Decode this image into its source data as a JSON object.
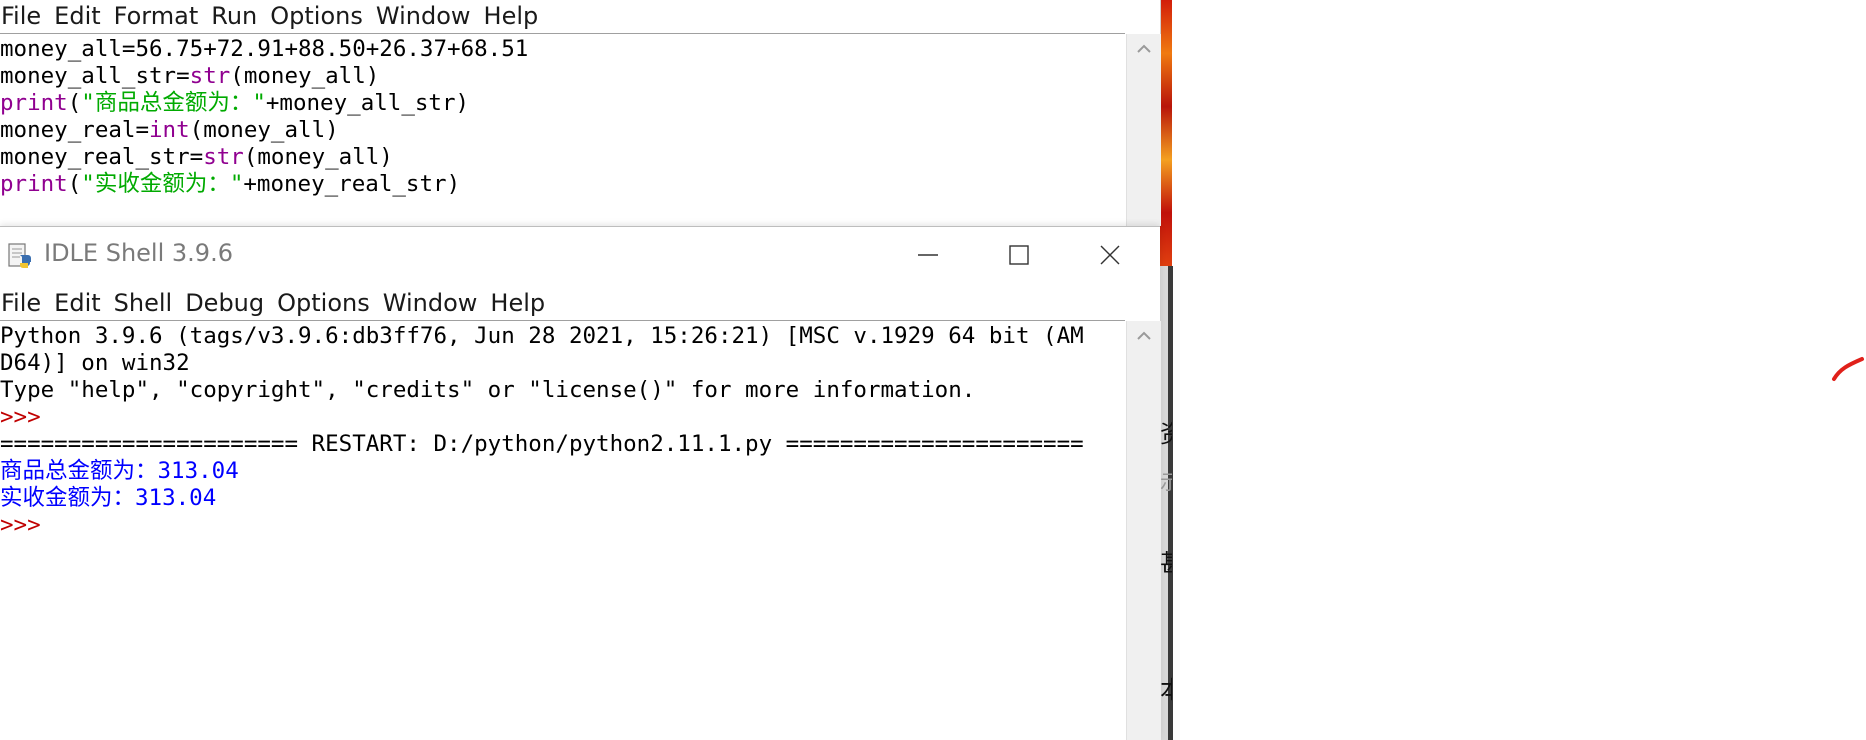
{
  "editor": {
    "menu": [
      "File",
      "Edit",
      "Format",
      "Run",
      "Options",
      "Window",
      "Help"
    ],
    "code_lines": [
      [
        {
          "t": "money_all=56.75+72.91+88.50+26.37+68.51",
          "c": "plain"
        }
      ],
      [
        {
          "t": "money_all_str=",
          "c": "plain"
        },
        {
          "t": "str",
          "c": "kw"
        },
        {
          "t": "(money_all)",
          "c": "plain"
        }
      ],
      [
        {
          "t": "print",
          "c": "kw"
        },
        {
          "t": "(",
          "c": "plain"
        },
        {
          "t": "\"商品总金额为：\"",
          "c": "str"
        },
        {
          "t": "+money_all_str)",
          "c": "plain"
        }
      ],
      [
        {
          "t": "money_real=",
          "c": "plain"
        },
        {
          "t": "int",
          "c": "kw"
        },
        {
          "t": "(money_all)",
          "c": "plain"
        }
      ],
      [
        {
          "t": "money_real_str=",
          "c": "plain"
        },
        {
          "t": "str",
          "c": "kw"
        },
        {
          "t": "(money_all)",
          "c": "plain"
        }
      ],
      [
        {
          "t": "print",
          "c": "kw"
        },
        {
          "t": "(",
          "c": "plain"
        },
        {
          "t": "\"实收金额为：\"",
          "c": "str"
        },
        {
          "t": "+money_real_str)",
          "c": "plain"
        }
      ]
    ]
  },
  "shell": {
    "title": "IDLE Shell 3.9.6",
    "menu": [
      "File",
      "Edit",
      "Shell",
      "Debug",
      "Options",
      "Window",
      "Help"
    ],
    "lines": [
      {
        "t": "Python 3.9.6 (tags/v3.9.6:db3ff76, Jun 28 2021, 15:26:21) [MSC v.1929 64 bit (AM",
        "c": "plain"
      },
      {
        "t": "D64)] on win32",
        "c": "plain"
      },
      {
        "t": "Type \"help\", \"copyright\", \"credits\" or \"license()\" for more information.",
        "c": "plain"
      },
      {
        "t": ">>> ",
        "c": "prompt"
      },
      {
        "t": "====================== RESTART: D:/python/python2.11.1.py ======================",
        "c": "plain"
      },
      {
        "t": "商品总金额为：313.04",
        "c": "out"
      },
      {
        "t": "实收金额为：313.04",
        "c": "out"
      },
      {
        "t": ">>> ",
        "c": "prompt"
      }
    ]
  },
  "colors": {
    "keyword": "#900090",
    "string": "#00aa00",
    "output": "#0000ff",
    "prompt": "#c00000"
  },
  "icons": {
    "app": "python-idle-icon",
    "minimize": "minimize-icon",
    "maximize": "maximize-icon",
    "close": "close-icon",
    "scroll_up": "chevron-up-icon"
  },
  "background_glyphs": [
    "资",
    "示",
    "甚",
    "本"
  ]
}
